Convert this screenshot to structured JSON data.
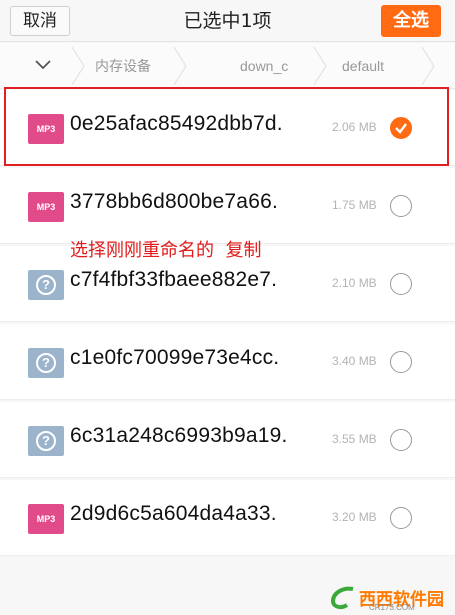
{
  "header": {
    "cancel_label": "取消",
    "title": "已选中1项",
    "select_all_label": "全选"
  },
  "breadcrumb": {
    "items": [
      "内存设备",
      "down_c",
      "default"
    ]
  },
  "files": [
    {
      "name": "0e25afac85492dbb7d.",
      "size": "2.06 MB",
      "type": "mp3",
      "checked": true
    },
    {
      "name": "3778bb6d800be7a66.",
      "size": "1.75 MB",
      "type": "mp3",
      "checked": false
    },
    {
      "name": "c7f4fbf33fbaee882e7.",
      "size": "2.10 MB",
      "type": "unknown",
      "checked": false
    },
    {
      "name": "c1e0fc70099e73e4cc.",
      "size": "3.40 MB",
      "type": "unknown",
      "checked": false
    },
    {
      "name": "6c31a248c6993b9a19.",
      "size": "3.55 MB",
      "type": "unknown",
      "checked": false
    },
    {
      "name": "2d9d6c5a604da4a33.",
      "size": "3.20 MB",
      "type": "mp3",
      "checked": false
    }
  ],
  "icon_labels": {
    "mp3": "MP3",
    "unknown": "?"
  },
  "annotation": "选择刚刚重命名的  复制",
  "watermark": {
    "text": "西西软件园",
    "sub": "CR173.COM"
  },
  "colors": {
    "accent": "#ff6a13",
    "mp3_icon": "#e24b8a",
    "unknown_icon": "#9bb4cc",
    "annotation": "#e21b1b"
  }
}
